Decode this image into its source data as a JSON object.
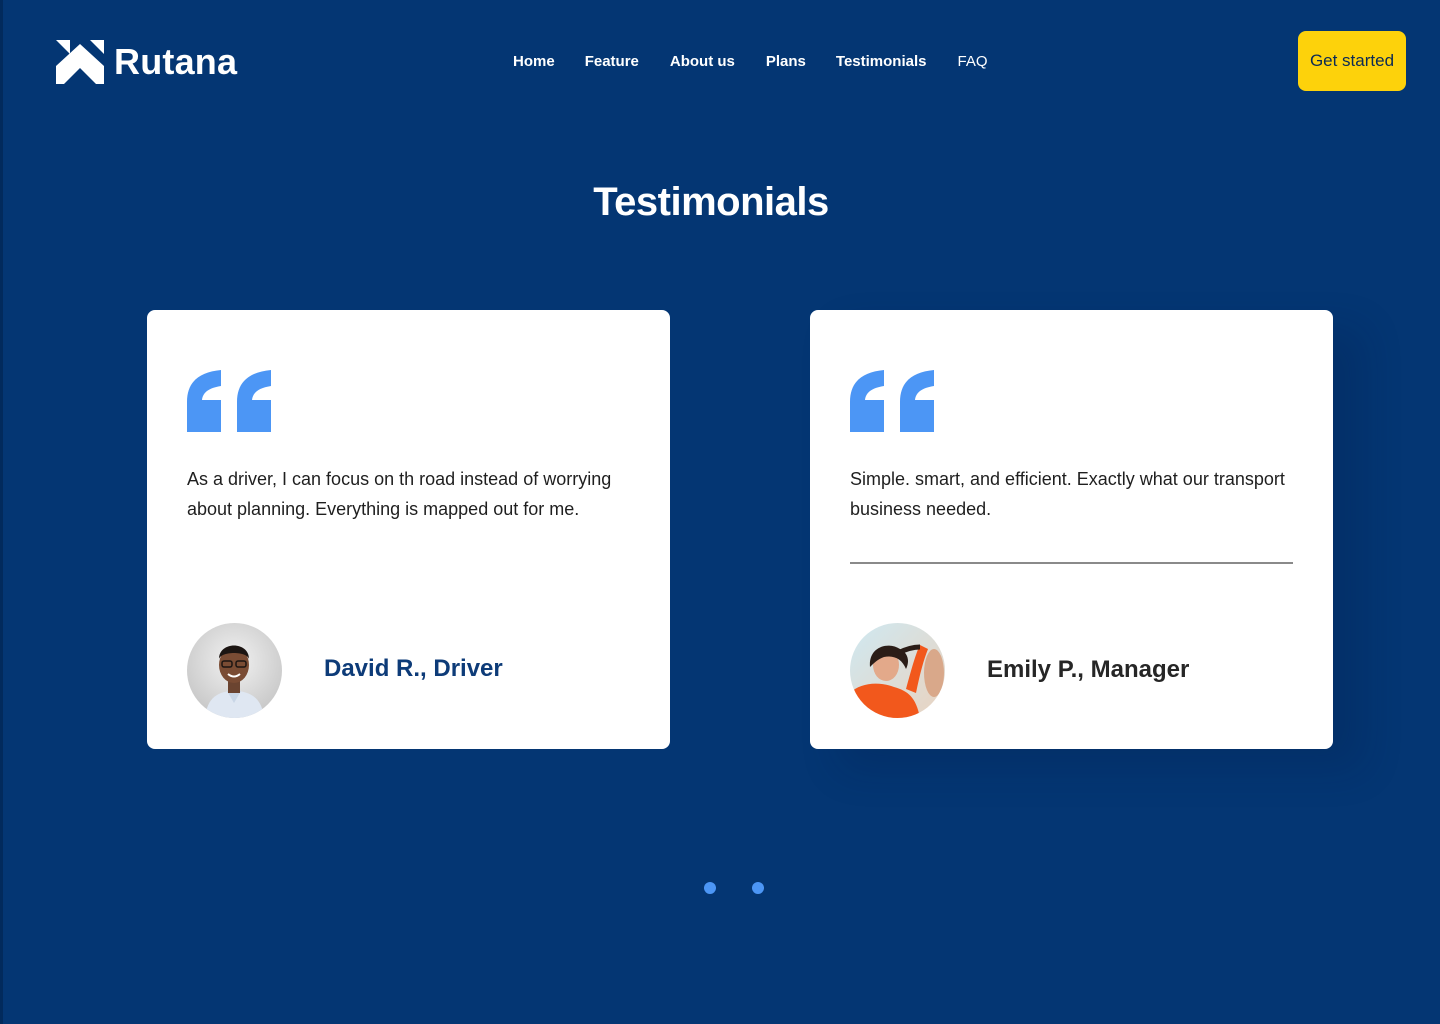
{
  "brand": {
    "name": "Rutana"
  },
  "nav": {
    "items": [
      {
        "label": "Home"
      },
      {
        "label": "Feature"
      },
      {
        "label": "About us"
      },
      {
        "label": "Plans"
      },
      {
        "label": "Testimonials"
      },
      {
        "label": "FAQ"
      }
    ]
  },
  "header": {
    "cta_label": "Get started"
  },
  "section": {
    "title": "Testimonials"
  },
  "testimonials": [
    {
      "quote": "As a driver, I can focus on th road instead of worrying about planning. Everything is mapped out for me.",
      "author": "David R., Driver",
      "avatar_icon": "person-avatar-icon"
    },
    {
      "quote": "Simple. smart, and efficient. Exactly what our transport business needed.",
      "author": "Emily P., Manager",
      "avatar_icon": "person-avatar-icon"
    }
  ],
  "pagination": {
    "count": 2
  },
  "colors": {
    "background": "#043673",
    "cta": "#fdd20b",
    "accent": "#4c96f5",
    "card": "#ffffff"
  }
}
